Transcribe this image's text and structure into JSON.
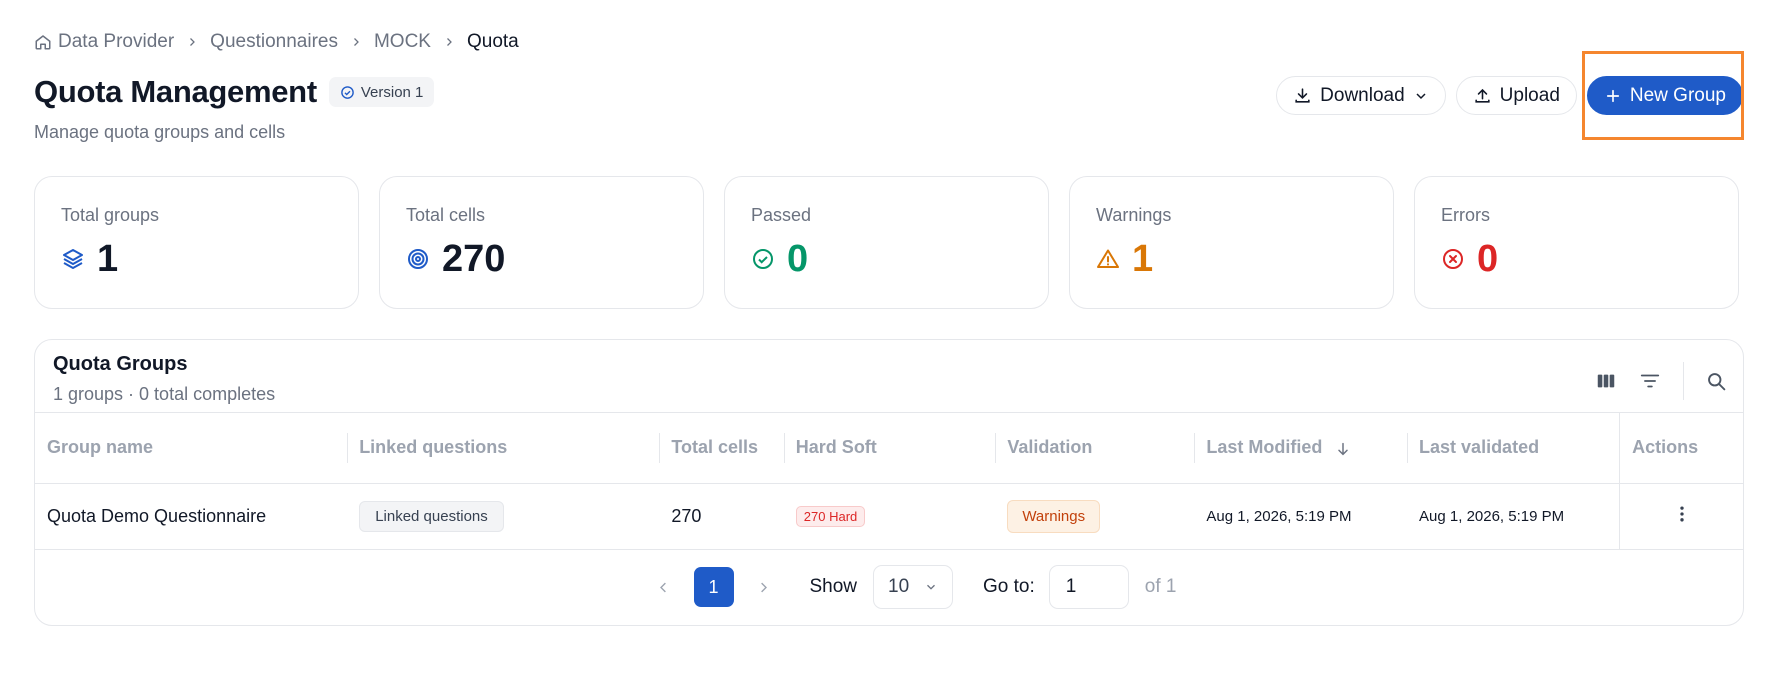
{
  "breadcrumb": {
    "items": [
      "Data Provider",
      "Questionnaires",
      "MOCK"
    ],
    "current": "Quota"
  },
  "header": {
    "title": "Quota Management",
    "version": "Version 1",
    "subtitle": "Manage quota groups and cells",
    "download_label": "Download",
    "upload_label": "Upload",
    "new_group_label": "New Group"
  },
  "stats": [
    {
      "label": "Total groups",
      "value": "1",
      "icon": "layers-icon",
      "color": "#111827"
    },
    {
      "label": "Total cells",
      "value": "270",
      "icon": "target-icon",
      "color": "#111827"
    },
    {
      "label": "Passed",
      "value": "0",
      "icon": "check-circle-icon",
      "color": "#059669"
    },
    {
      "label": "Warnings",
      "value": "1",
      "icon": "warning-triangle-icon",
      "color": "#d97706"
    },
    {
      "label": "Errors",
      "value": "0",
      "icon": "x-circle-icon",
      "color": "#dc2626"
    }
  ],
  "table": {
    "title": "Quota Groups",
    "subtitle": "1 groups · 0 total completes",
    "columns": [
      "Group name",
      "Linked questions",
      "Total cells",
      "Hard Soft",
      "Validation",
      "Last Modified",
      "Last validated",
      "Actions"
    ],
    "rows": [
      {
        "group_name": "Quota Demo Questionnaire",
        "linked_questions": "Linked questions",
        "total_cells": "270",
        "hard_soft": "270 Hard",
        "validation": "Warnings",
        "last_modified": "Aug 1, 2026, 5:19 PM",
        "last_validated": "Aug 1, 2026, 5:19 PM"
      }
    ]
  },
  "pagination": {
    "current_page": "1",
    "show_label": "Show",
    "page_size": "10",
    "goto_label": "Go to:",
    "goto_value": "1",
    "of_label": "of 1"
  },
  "colors": {
    "primary": "#1f5bc8",
    "highlight": "#f5862e",
    "success": "#059669",
    "warning": "#d97706",
    "error": "#dc2626"
  }
}
